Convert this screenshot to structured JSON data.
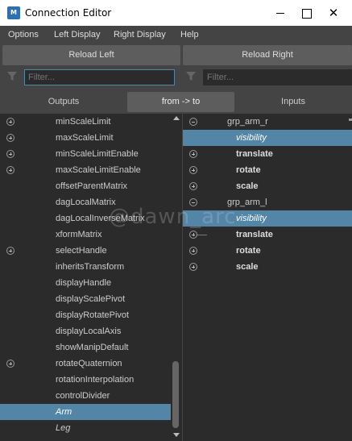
{
  "window": {
    "title": "Connection Editor",
    "app_icon_text": "M",
    "close_glyph": "✕"
  },
  "menu": [
    "Options",
    "Left Display",
    "Right Display",
    "Help"
  ],
  "buttons": {
    "reload_left": "Reload Left",
    "reload_right": "Reload Right"
  },
  "filters": {
    "left_placeholder": "Filter...",
    "right_placeholder": "Filter...",
    "left_value": "",
    "right_value": ""
  },
  "tabs": {
    "outputs": "Outputs",
    "from_to": "from -> to",
    "inputs": "Inputs"
  },
  "left_list": [
    {
      "label": "minScaleLimit",
      "expand": "plus",
      "selected": false,
      "italic": false
    },
    {
      "label": "maxScaleLimit",
      "expand": "plus",
      "selected": false,
      "italic": false
    },
    {
      "label": "minScaleLimitEnable",
      "expand": "plus",
      "selected": false,
      "italic": false
    },
    {
      "label": "maxScaleLimitEnable",
      "expand": "plus",
      "selected": false,
      "italic": false
    },
    {
      "label": "offsetParentMatrix",
      "expand": "",
      "selected": false,
      "italic": false
    },
    {
      "label": "dagLocalMatrix",
      "expand": "",
      "selected": false,
      "italic": false
    },
    {
      "label": "dagLocalInverseMatrix",
      "expand": "",
      "selected": false,
      "italic": false
    },
    {
      "label": "xformMatrix",
      "expand": "",
      "selected": false,
      "italic": false
    },
    {
      "label": "selectHandle",
      "expand": "plus",
      "selected": false,
      "italic": false
    },
    {
      "label": "inheritsTransform",
      "expand": "",
      "selected": false,
      "italic": false
    },
    {
      "label": "displayHandle",
      "expand": "",
      "selected": false,
      "italic": false
    },
    {
      "label": "displayScalePivot",
      "expand": "",
      "selected": false,
      "italic": false
    },
    {
      "label": "displayRotatePivot",
      "expand": "",
      "selected": false,
      "italic": false
    },
    {
      "label": "displayLocalAxis",
      "expand": "",
      "selected": false,
      "italic": false
    },
    {
      "label": "showManipDefault",
      "expand": "",
      "selected": false,
      "italic": false
    },
    {
      "label": "rotateQuaternion",
      "expand": "plus",
      "selected": false,
      "italic": false
    },
    {
      "label": "rotationInterpolation",
      "expand": "",
      "selected": false,
      "italic": false
    },
    {
      "label": "controlDivider",
      "expand": "",
      "selected": false,
      "italic": false
    },
    {
      "label": "Arm",
      "expand": "",
      "selected": true,
      "italic": true
    },
    {
      "label": "Leg",
      "expand": "",
      "selected": false,
      "italic": true
    }
  ],
  "right_list": [
    {
      "label": "grp_arm_r",
      "expand": "minus",
      "level": 0,
      "selected": false,
      "bold": false
    },
    {
      "label": "visibility",
      "expand": "",
      "level": 1,
      "selected": true,
      "bold": false
    },
    {
      "label": "translate",
      "expand": "plus",
      "level": 1,
      "selected": false,
      "bold": true
    },
    {
      "label": "rotate",
      "expand": "plus",
      "level": 1,
      "selected": false,
      "bold": true
    },
    {
      "label": "scale",
      "expand": "plus",
      "level": 1,
      "selected": false,
      "bold": true
    },
    {
      "label": "grp_arm_l",
      "expand": "minus",
      "level": 0,
      "selected": false,
      "bold": false
    },
    {
      "label": "visibility",
      "expand": "",
      "level": 1,
      "selected": true,
      "bold": false
    },
    {
      "label": "translate",
      "expand": "plus",
      "level": 1,
      "selected": false,
      "bold": true,
      "connector": true
    },
    {
      "label": "rotate",
      "expand": "plus",
      "level": 1,
      "selected": false,
      "bold": true
    },
    {
      "label": "scale",
      "expand": "plus",
      "level": 1,
      "selected": false,
      "bold": true
    }
  ],
  "watermark": "@dawn_arc",
  "colors": {
    "selection": "#5285a6",
    "panel_bg": "#2b2b2b",
    "chrome_bg": "#444444",
    "button_bg": "#5d5d5d"
  }
}
